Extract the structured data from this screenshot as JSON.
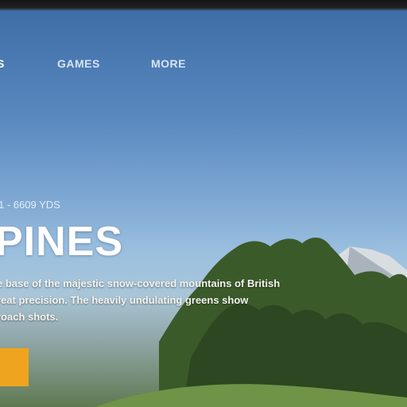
{
  "nav": {
    "items": [
      {
        "label": "S",
        "active": true
      },
      {
        "label": "GAMES",
        "active": false
      },
      {
        "label": "MORE",
        "active": false
      }
    ]
  },
  "course": {
    "meta": "1 - 6609 YDS",
    "title": "PINES",
    "description_lines": [
      "e base of the majestic snow-covered mountains of British",
      "reat precision. The heavily undulating greens show",
      "roach shots."
    ]
  },
  "colors": {
    "accent": "#efa41f",
    "sky_top": "#3e6da6",
    "sky_bottom": "#a9c6d8",
    "foliage": "#3b5a2a"
  }
}
